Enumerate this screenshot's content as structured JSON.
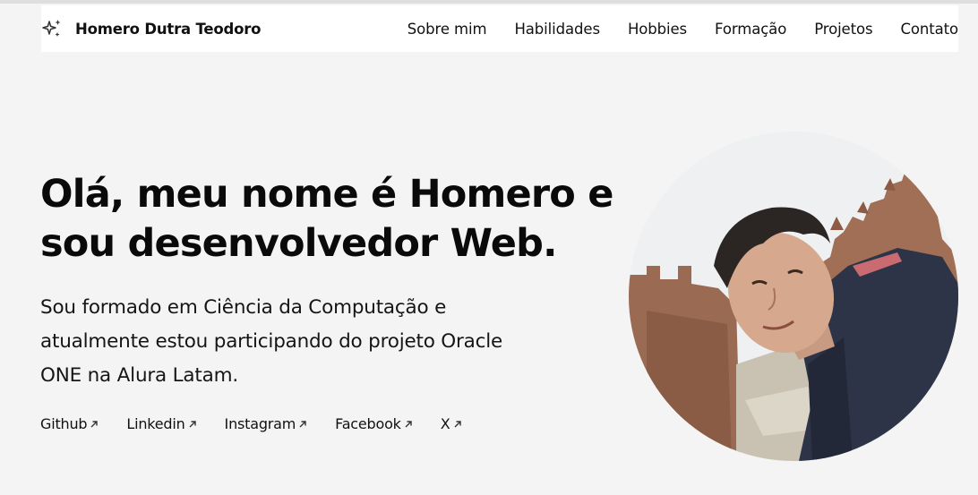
{
  "header": {
    "brand_name": "Homero Dutra Teodoro",
    "brand_icon": "sparkles-icon",
    "nav": [
      {
        "label": "Sobre mim"
      },
      {
        "label": "Habilidades"
      },
      {
        "label": "Hobbies"
      },
      {
        "label": "Formação"
      },
      {
        "label": "Projetos"
      },
      {
        "label": "Contato"
      }
    ]
  },
  "hero": {
    "title": "Olá, meu nome é Homero e sou desenvolvedor Web.",
    "subtitle": "Sou formado em Ciência da Computação e atualmente estou participando do projeto Oracle ONE na Alura Latam.",
    "social": [
      {
        "label": "Github",
        "icon": "arrow-up-right-icon"
      },
      {
        "label": "Linkedin",
        "icon": "arrow-up-right-icon"
      },
      {
        "label": "Instagram",
        "icon": "arrow-up-right-icon"
      },
      {
        "label": "Facebook",
        "icon": "arrow-up-right-icon"
      },
      {
        "label": "X",
        "icon": "arrow-up-right-icon"
      }
    ]
  },
  "colors": {
    "background": "#f4f4f4",
    "navbar": "#ffffff",
    "text": "#111111"
  }
}
